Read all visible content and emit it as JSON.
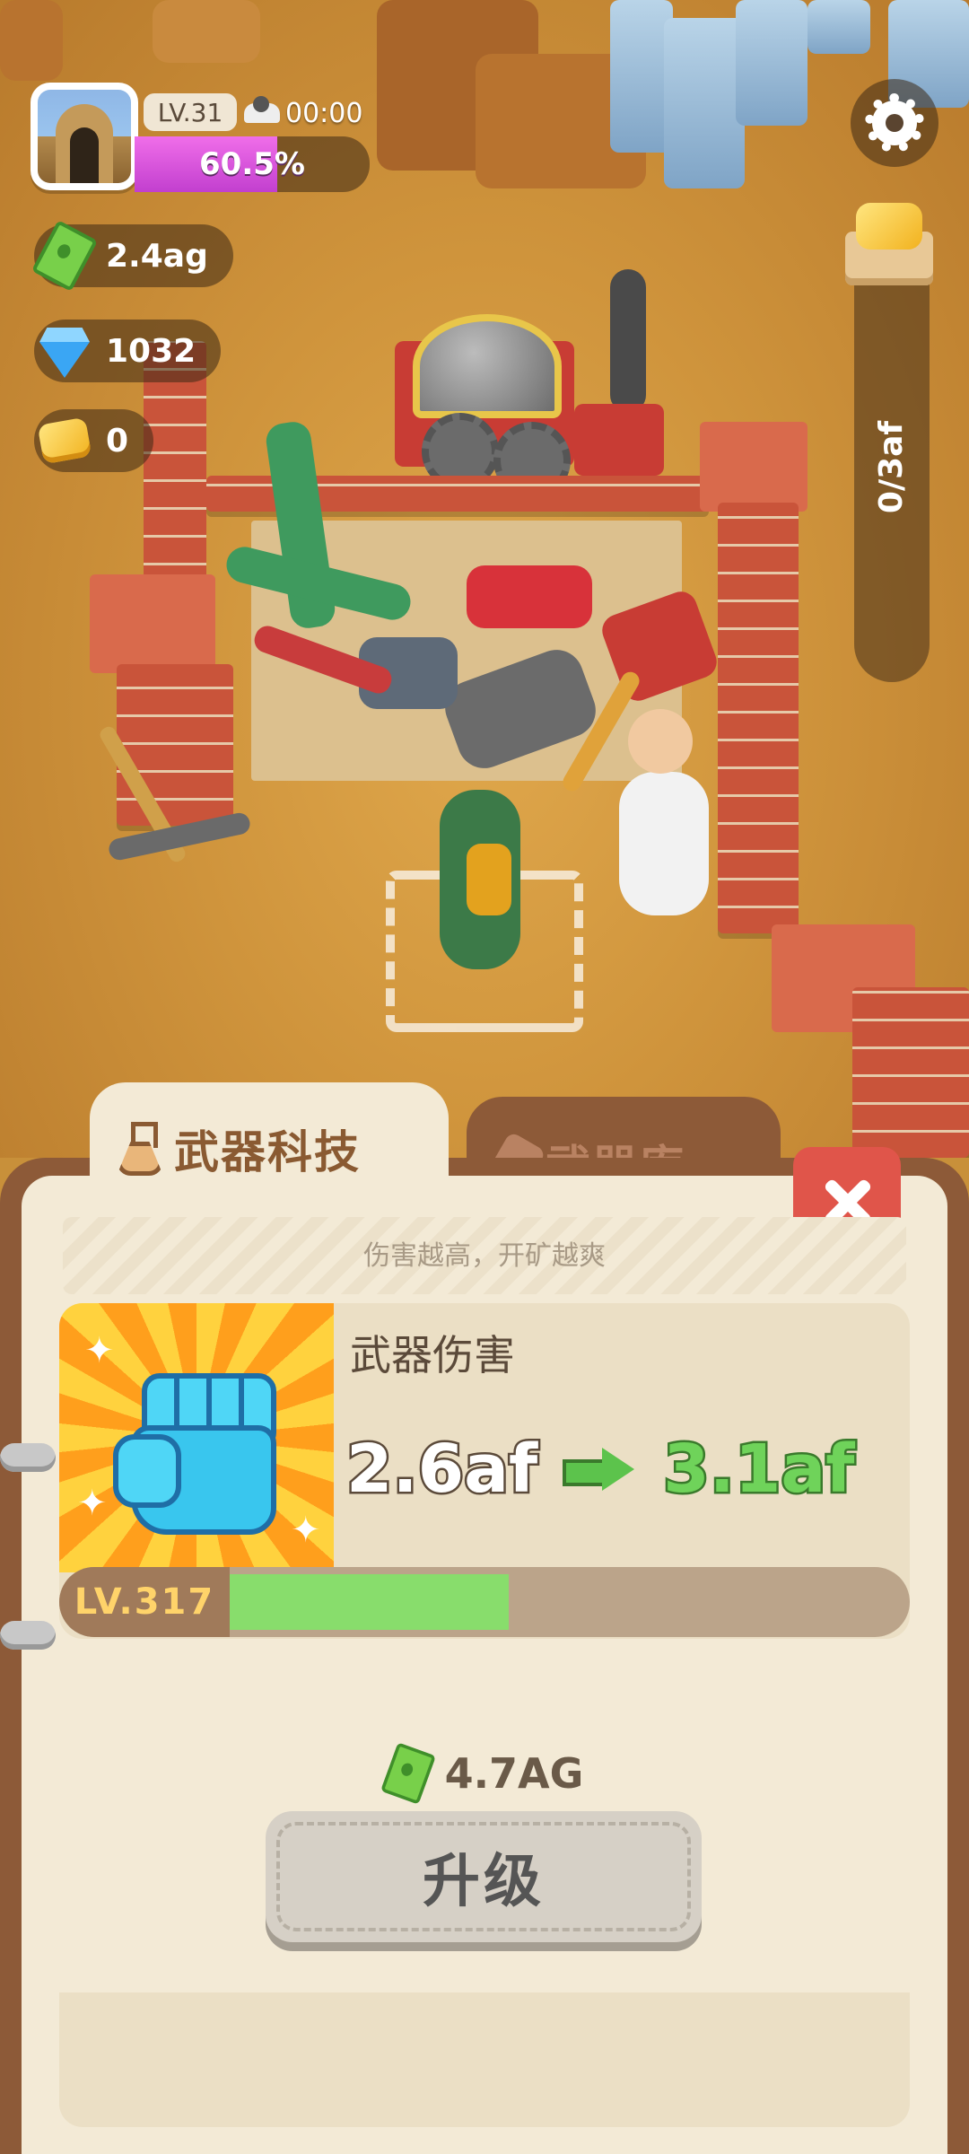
{
  "hud": {
    "level": "LV.31",
    "timer": "00:00",
    "progress_text": "60.5%",
    "progress_value": 0.605,
    "cash": "2.4ag",
    "gems": "1032",
    "gold": "0",
    "ore_capacity": "0/3af"
  },
  "tabs": {
    "active_label": "武器科技",
    "inactive_label": "武器库"
  },
  "panel": {
    "subtitle": "伤害越高，开矿越爽",
    "stat_title": "武器伤害",
    "stat_from": "2.6af",
    "stat_to": "3.1af",
    "level_label": "LV.317",
    "level_progress": 0.41,
    "cost": "4.7AG",
    "upgrade_label": "升级"
  },
  "colors": {
    "progress": "#d84fe0",
    "level_fill": "#88dd6c",
    "close_button": "#e0554a",
    "panel_frame": "#8d5a38",
    "panel_bg": "#f3ead6"
  },
  "icons": [
    "mine-avatar-icon",
    "cloud-icon",
    "cash-icon",
    "gem-icon",
    "gold-icon",
    "gear-icon",
    "ore-crate-icon",
    "flask-icon",
    "dynamite-icon",
    "close-icon",
    "fist-icon",
    "arrow-right-icon"
  ]
}
